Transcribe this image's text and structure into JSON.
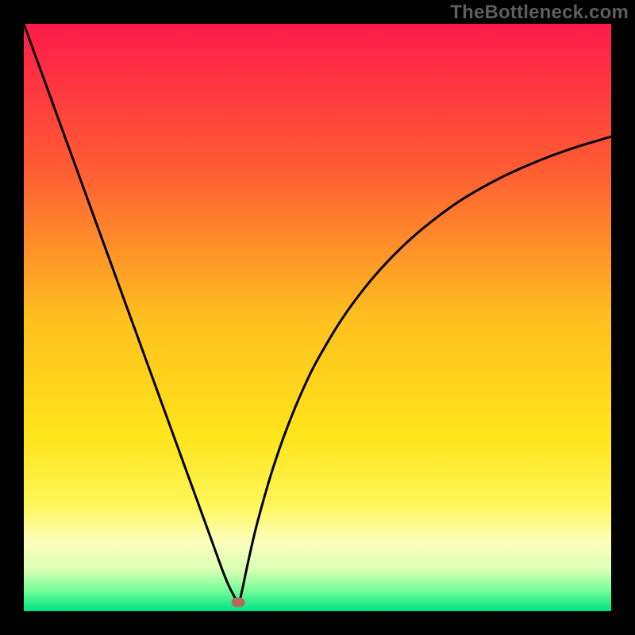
{
  "watermark": "TheBottleneck.com",
  "colors": {
    "background": "#000000",
    "curve": "#000000",
    "marker": "#b66a5a",
    "gradient_stops": [
      {
        "offset": 0.0,
        "color": "#ff1a4b"
      },
      {
        "offset": 0.25,
        "color": "#ff5d33"
      },
      {
        "offset": 0.5,
        "color": "#ffbf1f"
      },
      {
        "offset": 0.7,
        "color": "#ffe419"
      },
      {
        "offset": 0.82,
        "color": "#fff65a"
      },
      {
        "offset": 0.88,
        "color": "#fdffbc"
      },
      {
        "offset": 0.93,
        "color": "#d9ffb3"
      },
      {
        "offset": 0.965,
        "color": "#73ff9a"
      },
      {
        "offset": 1.0,
        "color": "#00e183"
      }
    ]
  },
  "chart_data": {
    "type": "line",
    "title": "",
    "xlabel": "",
    "ylabel": "",
    "xlim": [
      0,
      100
    ],
    "ylim": [
      0,
      100
    ],
    "marker_xy": [
      36.5,
      1.5
    ],
    "series": [
      {
        "name": "curve",
        "x": [
          0,
          2,
          4,
          6,
          8,
          10,
          12,
          14,
          16,
          18,
          20,
          22,
          24,
          26,
          28,
          30,
          32,
          33,
          34,
          35,
          36,
          36.5,
          37,
          38,
          39,
          40,
          42,
          44,
          46,
          48,
          50,
          54,
          58,
          62,
          66,
          70,
          74,
          78,
          82,
          86,
          90,
          94,
          98,
          100
        ],
        "y": [
          100,
          94.5,
          89,
          83.5,
          78,
          72.5,
          67,
          61.5,
          56,
          50.5,
          45,
          39.5,
          34,
          28.5,
          23,
          17.5,
          12,
          9.2,
          6.5,
          4.1,
          2.2,
          1.2,
          2.8,
          7.5,
          12.0,
          16.0,
          23.0,
          29.0,
          34.2,
          38.8,
          42.8,
          49.5,
          55.0,
          59.6,
          63.5,
          66.8,
          69.7,
          72.1,
          74.2,
          76.0,
          77.6,
          79.0,
          80.2,
          80.8
        ]
      }
    ]
  }
}
